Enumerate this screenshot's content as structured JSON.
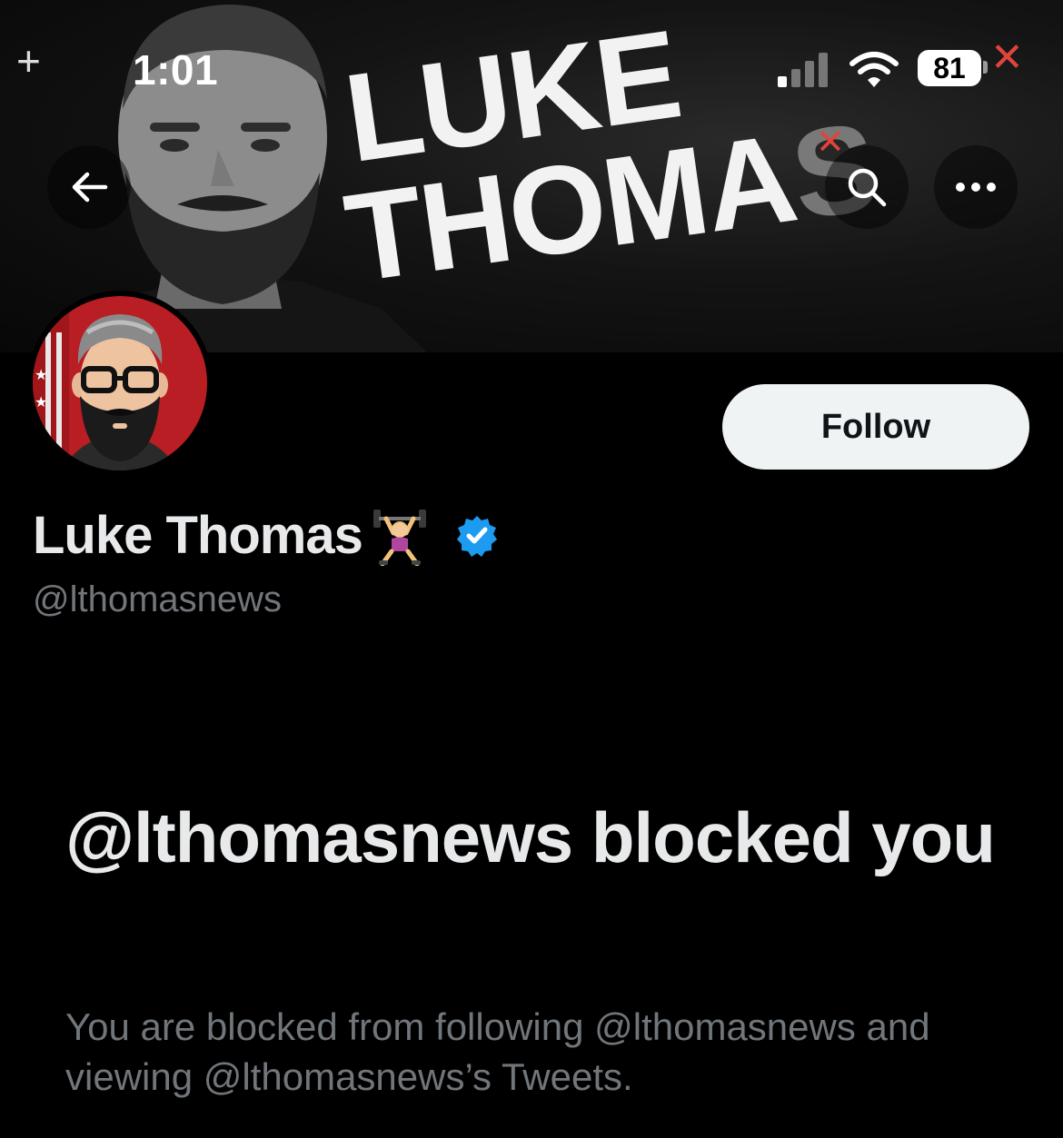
{
  "status_bar": {
    "time": "1:01",
    "battery": "81"
  },
  "banner": {
    "title_line1": "LUKE",
    "title_line2": "THOMAS"
  },
  "nav": {
    "back_icon": "arrow-left-icon",
    "search_icon": "search-icon",
    "more_icon": "more-icon"
  },
  "profile": {
    "display_name": "Luke Thomas",
    "name_emoji": "🏋️‍♀️",
    "verified_color": "#1d9bf0",
    "handle": "@lthomasnews",
    "follow_label": "Follow"
  },
  "blocked": {
    "title": "@lthomasnews blocked you",
    "description": "You are blocked from following @lthomasnews and viewing @lthomasnews’s Tweets."
  }
}
